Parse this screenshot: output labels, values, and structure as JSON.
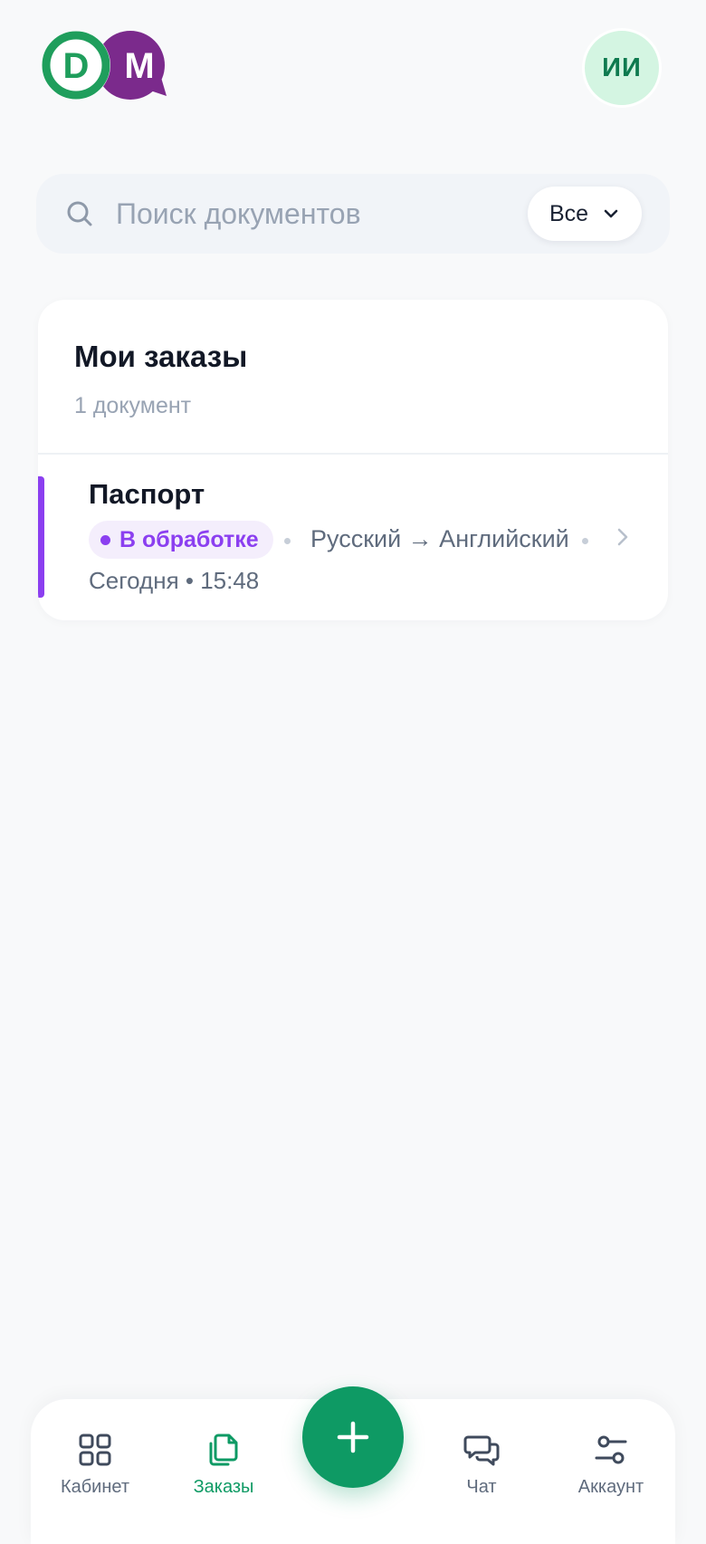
{
  "header": {
    "logo_letters": [
      "D",
      "M"
    ],
    "avatar_initials": "ИИ"
  },
  "search": {
    "placeholder": "Поиск документов",
    "value": "",
    "filter_label": "Все"
  },
  "orders": {
    "title": "Мои заказы",
    "subtitle": "1 документ",
    "items": [
      {
        "title": "Паспорт",
        "status": "В обработке",
        "languages": "Русский → Английский",
        "date": "Сегодня • 15:48"
      }
    ]
  },
  "bottom_nav": {
    "items": [
      {
        "label": "Кабинет",
        "icon": "grid-icon",
        "active": false
      },
      {
        "label": "Заказы",
        "icon": "documents-icon",
        "active": true
      },
      {
        "label": "Чат",
        "icon": "chat-icon",
        "active": false
      },
      {
        "label": "Аккаунт",
        "icon": "sliders-icon",
        "active": false
      }
    ],
    "fab_icon": "plus-icon"
  },
  "colors": {
    "brand_green": "#0e9a64",
    "brand_purple": "#7b2a8c",
    "status_purple": "#8b3ff0",
    "background": "#f8f9fa"
  }
}
